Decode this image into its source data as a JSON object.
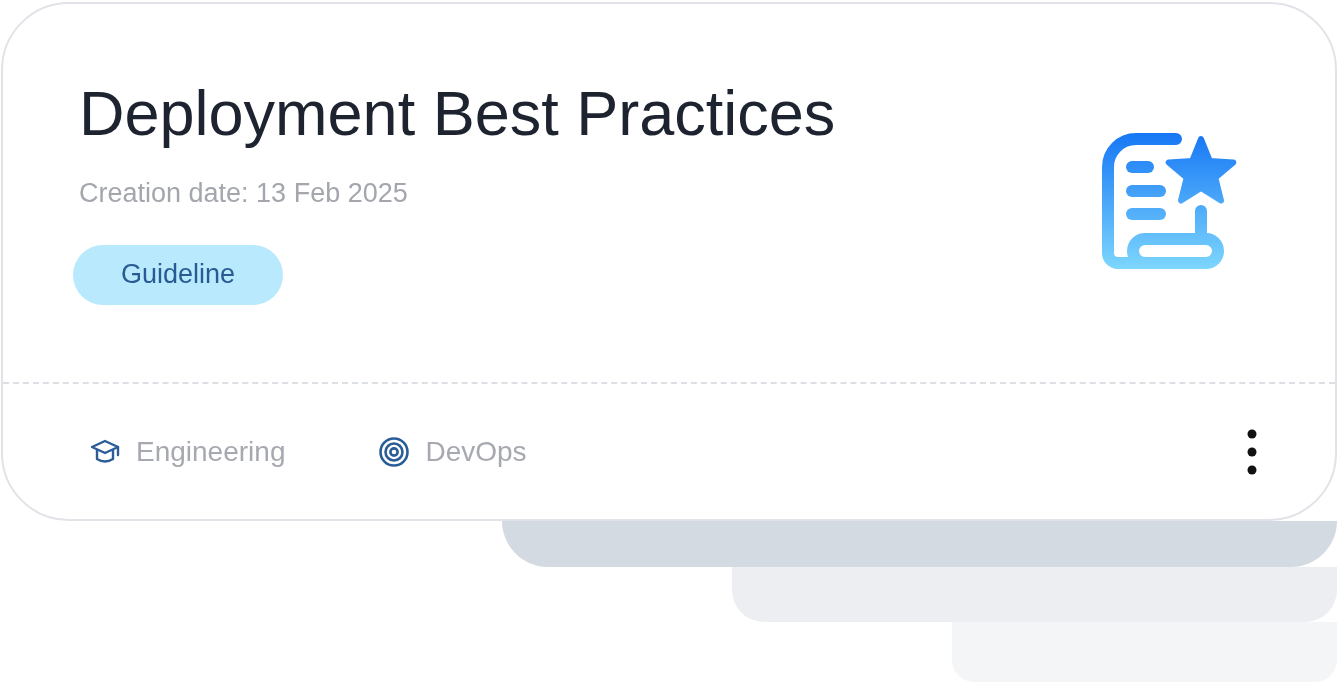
{
  "card": {
    "title": "Deployment Best Practices",
    "creation_date": "Creation date: 13 Feb 2025",
    "tag": "Guideline"
  },
  "footer": {
    "items": [
      {
        "kind": "department",
        "label": "Engineering"
      },
      {
        "kind": "team",
        "label": "DevOps"
      }
    ]
  }
}
